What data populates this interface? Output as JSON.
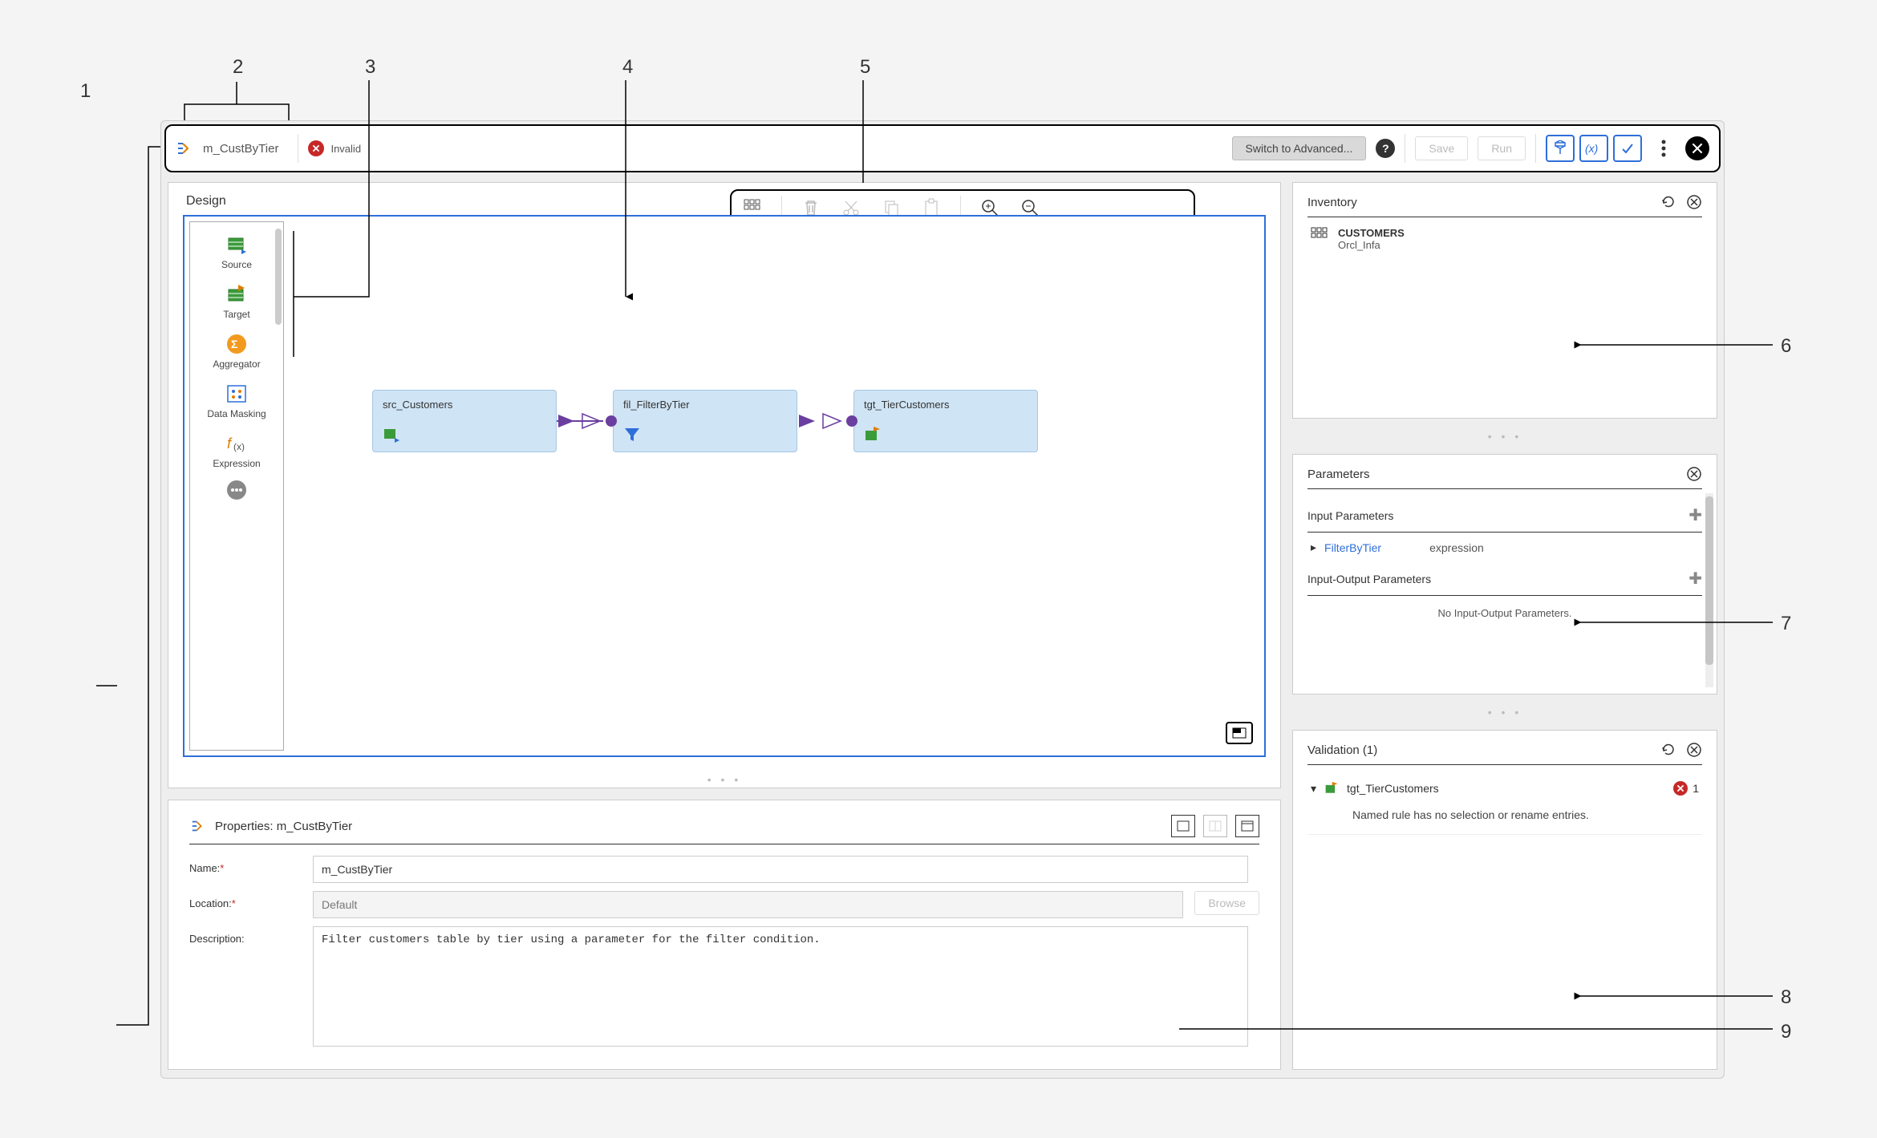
{
  "header": {
    "mapping_name": "m_CustByTier",
    "status_text": "Invalid",
    "switch_btn": "Switch to Advanced...",
    "save_btn": "Save",
    "run_btn": "Run"
  },
  "callouts": {
    "n1": "1",
    "n2": "2",
    "n3": "3",
    "n4": "4",
    "n5": "5",
    "n6": "6",
    "n7": "7",
    "n8": "8",
    "n9": "9"
  },
  "design": {
    "title": "Design",
    "palette": [
      {
        "label": "Source"
      },
      {
        "label": "Target"
      },
      {
        "label": "Aggregator"
      },
      {
        "label": "Data Masking"
      },
      {
        "label": "Expression"
      }
    ],
    "nodes": [
      {
        "id": "src",
        "label": "src_Customers"
      },
      {
        "id": "fil",
        "label": "fil_FilterByTier"
      },
      {
        "id": "tgt",
        "label": "tgt_TierCustomers"
      }
    ]
  },
  "properties": {
    "title": "Properties: m_CustByTier",
    "labels": {
      "name": "Name:",
      "location": "Location:",
      "description": "Description:",
      "browse": "Browse"
    },
    "values": {
      "name": "m_CustByTier",
      "location": "Default",
      "description": "Filter customers table by tier using a parameter for the filter condition."
    }
  },
  "inventory": {
    "title": "Inventory",
    "item_name": "CUSTOMERS",
    "item_sub": "Orcl_Infa"
  },
  "parameters": {
    "title": "Parameters",
    "section_input": "Input Parameters",
    "section_io": "Input-Output Parameters",
    "items": [
      {
        "name": "FilterByTier",
        "type": "expression"
      }
    ],
    "io_empty": "No Input-Output Parameters."
  },
  "validation": {
    "title": "Validation (1)",
    "item_name": "tgt_TierCustomers",
    "count": "1",
    "message": "Named rule has no selection or rename entries."
  }
}
